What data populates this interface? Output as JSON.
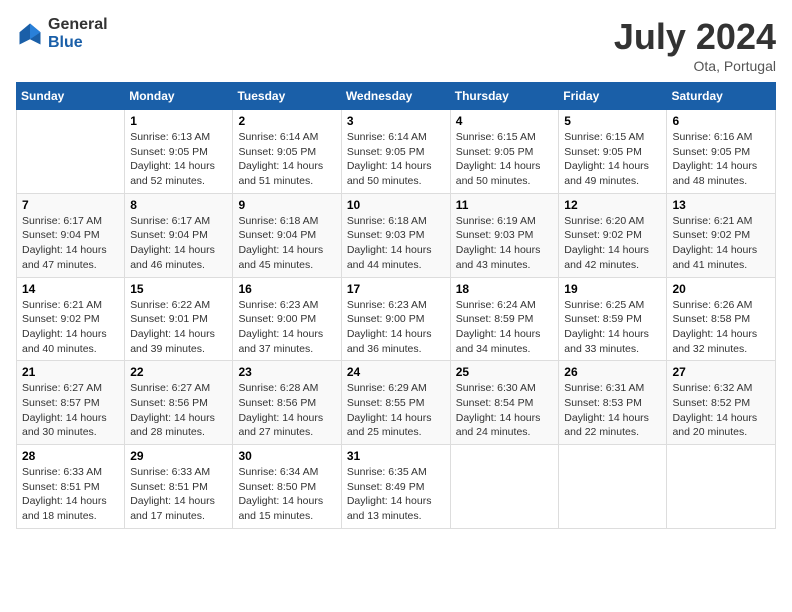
{
  "header": {
    "logo_general": "General",
    "logo_blue": "Blue",
    "title": "July 2024",
    "location": "Ota, Portugal"
  },
  "columns": [
    "Sunday",
    "Monday",
    "Tuesday",
    "Wednesday",
    "Thursday",
    "Friday",
    "Saturday"
  ],
  "weeks": [
    {
      "days": [
        {
          "num": "",
          "info": ""
        },
        {
          "num": "1",
          "info": "Sunrise: 6:13 AM\nSunset: 9:05 PM\nDaylight: 14 hours\nand 52 minutes."
        },
        {
          "num": "2",
          "info": "Sunrise: 6:14 AM\nSunset: 9:05 PM\nDaylight: 14 hours\nand 51 minutes."
        },
        {
          "num": "3",
          "info": "Sunrise: 6:14 AM\nSunset: 9:05 PM\nDaylight: 14 hours\nand 50 minutes."
        },
        {
          "num": "4",
          "info": "Sunrise: 6:15 AM\nSunset: 9:05 PM\nDaylight: 14 hours\nand 50 minutes."
        },
        {
          "num": "5",
          "info": "Sunrise: 6:15 AM\nSunset: 9:05 PM\nDaylight: 14 hours\nand 49 minutes."
        },
        {
          "num": "6",
          "info": "Sunrise: 6:16 AM\nSunset: 9:05 PM\nDaylight: 14 hours\nand 48 minutes."
        }
      ]
    },
    {
      "days": [
        {
          "num": "7",
          "info": "Sunrise: 6:17 AM\nSunset: 9:04 PM\nDaylight: 14 hours\nand 47 minutes."
        },
        {
          "num": "8",
          "info": "Sunrise: 6:17 AM\nSunset: 9:04 PM\nDaylight: 14 hours\nand 46 minutes."
        },
        {
          "num": "9",
          "info": "Sunrise: 6:18 AM\nSunset: 9:04 PM\nDaylight: 14 hours\nand 45 minutes."
        },
        {
          "num": "10",
          "info": "Sunrise: 6:18 AM\nSunset: 9:03 PM\nDaylight: 14 hours\nand 44 minutes."
        },
        {
          "num": "11",
          "info": "Sunrise: 6:19 AM\nSunset: 9:03 PM\nDaylight: 14 hours\nand 43 minutes."
        },
        {
          "num": "12",
          "info": "Sunrise: 6:20 AM\nSunset: 9:02 PM\nDaylight: 14 hours\nand 42 minutes."
        },
        {
          "num": "13",
          "info": "Sunrise: 6:21 AM\nSunset: 9:02 PM\nDaylight: 14 hours\nand 41 minutes."
        }
      ]
    },
    {
      "days": [
        {
          "num": "14",
          "info": "Sunrise: 6:21 AM\nSunset: 9:02 PM\nDaylight: 14 hours\nand 40 minutes."
        },
        {
          "num": "15",
          "info": "Sunrise: 6:22 AM\nSunset: 9:01 PM\nDaylight: 14 hours\nand 39 minutes."
        },
        {
          "num": "16",
          "info": "Sunrise: 6:23 AM\nSunset: 9:00 PM\nDaylight: 14 hours\nand 37 minutes."
        },
        {
          "num": "17",
          "info": "Sunrise: 6:23 AM\nSunset: 9:00 PM\nDaylight: 14 hours\nand 36 minutes."
        },
        {
          "num": "18",
          "info": "Sunrise: 6:24 AM\nSunset: 8:59 PM\nDaylight: 14 hours\nand 34 minutes."
        },
        {
          "num": "19",
          "info": "Sunrise: 6:25 AM\nSunset: 8:59 PM\nDaylight: 14 hours\nand 33 minutes."
        },
        {
          "num": "20",
          "info": "Sunrise: 6:26 AM\nSunset: 8:58 PM\nDaylight: 14 hours\nand 32 minutes."
        }
      ]
    },
    {
      "days": [
        {
          "num": "21",
          "info": "Sunrise: 6:27 AM\nSunset: 8:57 PM\nDaylight: 14 hours\nand 30 minutes."
        },
        {
          "num": "22",
          "info": "Sunrise: 6:27 AM\nSunset: 8:56 PM\nDaylight: 14 hours\nand 28 minutes."
        },
        {
          "num": "23",
          "info": "Sunrise: 6:28 AM\nSunset: 8:56 PM\nDaylight: 14 hours\nand 27 minutes."
        },
        {
          "num": "24",
          "info": "Sunrise: 6:29 AM\nSunset: 8:55 PM\nDaylight: 14 hours\nand 25 minutes."
        },
        {
          "num": "25",
          "info": "Sunrise: 6:30 AM\nSunset: 8:54 PM\nDaylight: 14 hours\nand 24 minutes."
        },
        {
          "num": "26",
          "info": "Sunrise: 6:31 AM\nSunset: 8:53 PM\nDaylight: 14 hours\nand 22 minutes."
        },
        {
          "num": "27",
          "info": "Sunrise: 6:32 AM\nSunset: 8:52 PM\nDaylight: 14 hours\nand 20 minutes."
        }
      ]
    },
    {
      "days": [
        {
          "num": "28",
          "info": "Sunrise: 6:33 AM\nSunset: 8:51 PM\nDaylight: 14 hours\nand 18 minutes."
        },
        {
          "num": "29",
          "info": "Sunrise: 6:33 AM\nSunset: 8:51 PM\nDaylight: 14 hours\nand 17 minutes."
        },
        {
          "num": "30",
          "info": "Sunrise: 6:34 AM\nSunset: 8:50 PM\nDaylight: 14 hours\nand 15 minutes."
        },
        {
          "num": "31",
          "info": "Sunrise: 6:35 AM\nSunset: 8:49 PM\nDaylight: 14 hours\nand 13 minutes."
        },
        {
          "num": "",
          "info": ""
        },
        {
          "num": "",
          "info": ""
        },
        {
          "num": "",
          "info": ""
        }
      ]
    }
  ]
}
